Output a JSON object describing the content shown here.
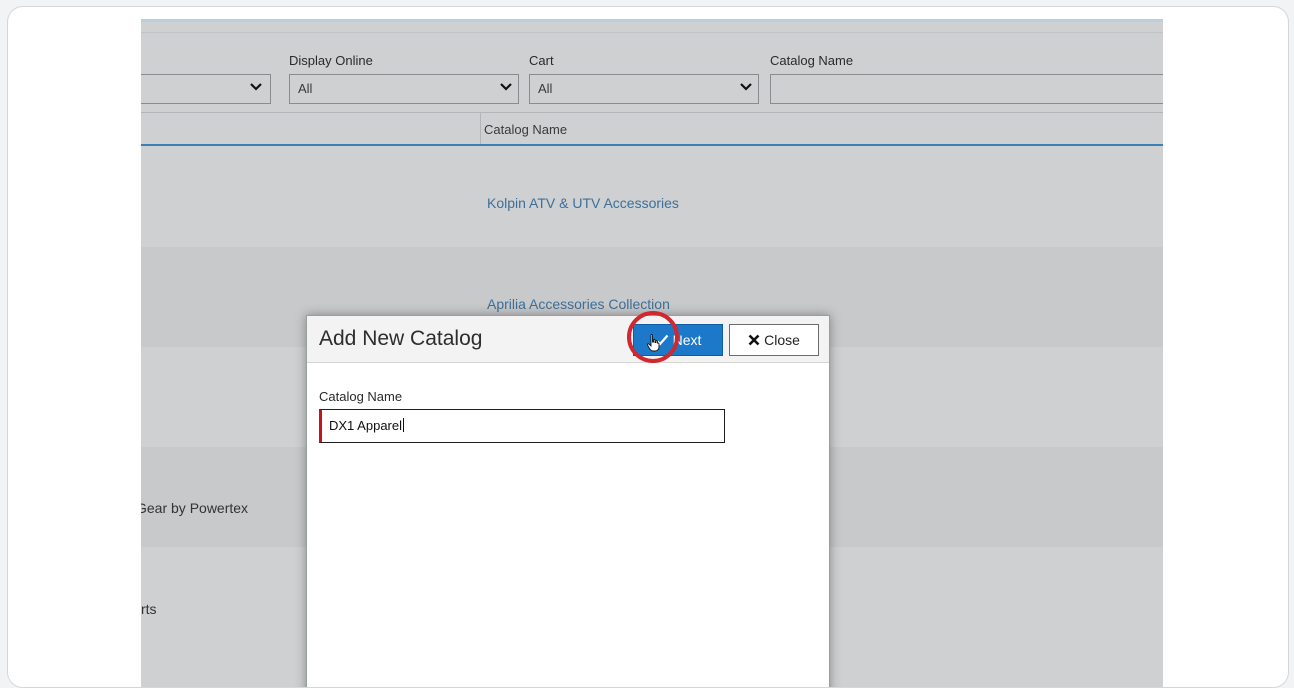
{
  "filters": {
    "display_online": {
      "label": "Display Online",
      "value": "All"
    },
    "cart": {
      "label": "Cart",
      "value": "All"
    },
    "catalog_name": {
      "label": "Catalog Name",
      "value": ""
    }
  },
  "table": {
    "column_header": "Catalog Name",
    "rows": [
      {
        "catalog_name": "Kolpin ATV & UTV Accessories",
        "left_text": ""
      },
      {
        "catalog_name": "Aprilia Accessories Collection",
        "left_text": ""
      },
      {
        "catalog_name": "",
        "left_text": ""
      },
      {
        "catalog_name": "",
        "left_text": "Gear by Powertex"
      },
      {
        "catalog_name": "",
        "left_text": "rts"
      }
    ]
  },
  "modal": {
    "title": "Add New Catalog",
    "next_label": "Next",
    "close_label": "Close",
    "field_label": "Catalog Name",
    "field_value": "DX1 Apparel"
  },
  "colors": {
    "primary_button": "#1c79c9",
    "highlight_ring": "#d1272e",
    "link": "#3d6f9a",
    "header_accent": "#3b7fb4"
  }
}
